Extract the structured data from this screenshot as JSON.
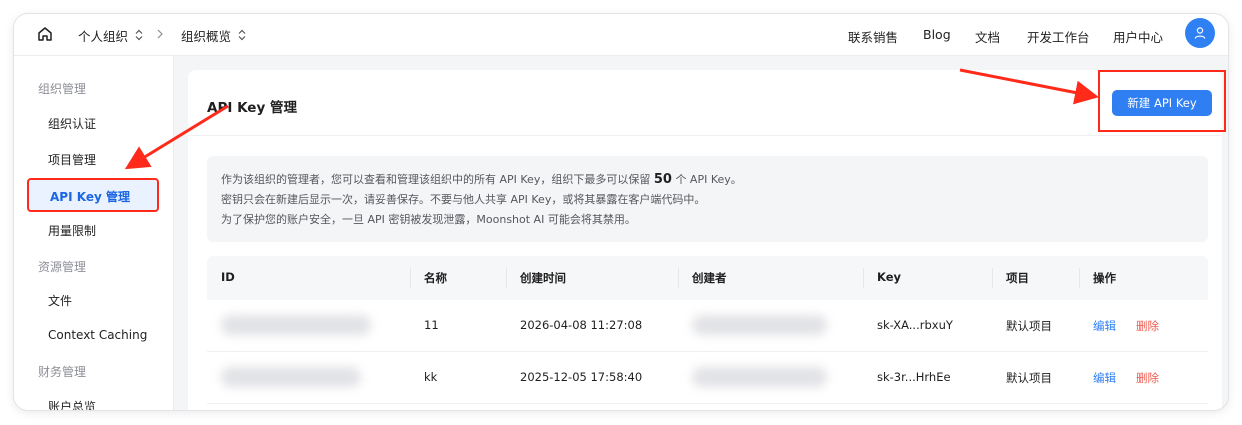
{
  "topbar": {
    "org": "个人组织",
    "page": "组织概览",
    "links": [
      "联系销售",
      "Blog",
      "文档",
      "开发工作台",
      "用户中心"
    ]
  },
  "sidebar": {
    "groups": [
      {
        "label": "组织管理",
        "items": [
          "组织认证",
          "项目管理",
          "API Key 管理",
          "用量限制"
        ]
      },
      {
        "label": "资源管理",
        "items": [
          "文件",
          "Context Caching"
        ]
      },
      {
        "label": "财务管理",
        "items": [
          "账户总览"
        ]
      }
    ],
    "active": "API Key 管理"
  },
  "main": {
    "title": "API Key 管理",
    "new_button": "新建 API Key",
    "notice": {
      "line1_prefix": "作为该组织的管理者，您可以查看和管理该组织中的所有 API Key，组织下最多可以保留",
      "line1_count": "50",
      "line1_suffix": "个 API Key。",
      "line2": "密钥只会在新建后显示一次，请妥善保存。不要与他人共享 API Key，或将其暴露在客户端代码中。",
      "line3": "为了保护您的账户安全，一旦 API 密钥被发现泄露，Moonshot AI 可能会将其禁用。"
    },
    "table": {
      "columns": [
        "ID",
        "名称",
        "创建时间",
        "创建者",
        "Key",
        "项目",
        "操作"
      ],
      "rows": [
        {
          "name": "11",
          "created": "2026-04-08 11:27:08",
          "key": "sk-XA...rbxuY",
          "project": "默认项目",
          "edit": "编辑",
          "delete": "删除"
        },
        {
          "name": "kk",
          "created": "2025-12-05 17:58:40",
          "key": "sk-3r...HrhEe",
          "project": "默认项目",
          "edit": "编辑",
          "delete": "删除"
        }
      ]
    }
  },
  "colors": {
    "accent": "#2f7ff2",
    "danger": "#f05a4f",
    "annotation": "#ff2a1a"
  }
}
